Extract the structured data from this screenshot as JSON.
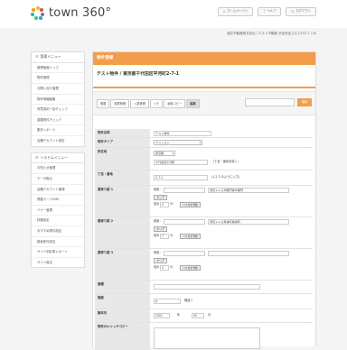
{
  "header": {
    "logo_text": "town 360°",
    "links": [
      {
        "icon": "home-icon",
        "glyph": "⌂",
        "label": "ホームページへ"
      },
      {
        "icon": "help-icon",
        "glyph": "?",
        "label": "ヘルプ"
      },
      {
        "icon": "logout-icon",
        "glyph": "⏻",
        "label": "ログアウト"
      }
    ],
    "login_info": "酒井不動産株式会社 / テスト不動産 渋谷売出さんでログイン中"
  },
  "sidebar": {
    "admin_title": "管理メニュー",
    "admin_items": [
      "管理画面トップ",
      "物件管理",
      "お問い合せ管理",
      "物件情報編集",
      "売買成約一括チェック",
      "重要物件チェック",
      "集計レポート",
      "店舗アカウント設定"
    ],
    "system_title": "システムメニュー",
    "system_items": [
      "お知らせ管理",
      "データ取込",
      "店舗アカウント管理",
      "掲載ページCMS",
      "バナー管理",
      "特集設定",
      "おすすめ物件設定",
      "検索条件設定",
      "サイト別記事レポート",
      "サイト設定"
    ]
  },
  "main": {
    "panel_title": "物件登録",
    "record_title": "テスト物件 / 東京都千代田区平河町2-7-1",
    "tabs": [
      "概要",
      "部屋管理",
      "入居管理",
      "メモ",
      "画像コピー",
      "編集"
    ],
    "search_button": "検索",
    "form": {
      "name_label": "物件名称",
      "name_value": "テスト物件",
      "type_label": "物件タイプ",
      "type_value": "マンション",
      "location_label": "所在地",
      "pref_value": "東京都",
      "address_value": "千代田区平河町",
      "address_note": "（丁目・番地を除く）",
      "chome_label": "丁目・番地",
      "chome_value": "2-7-1",
      "chome_note": "(1-2-3 のように入力)",
      "station1_label": "最寄り駅 1",
      "station2_label": "最寄り駅 2",
      "station3_label": "最寄り駅 3",
      "search_label": "検索：",
      "station1_value": "東京メトロ半蔵門線半蔵門",
      "station2_value": "東京メトロ有楽町線麹町",
      "clear_button": "クリア",
      "walk_label": "徒歩",
      "walk1_value": "5",
      "walk2_value": "7",
      "walk3_value": "0",
      "walk_unit": "分",
      "bus_button": "バス分を登録",
      "area_label": "面積",
      "floors_label": "階建",
      "floors_value": "8",
      "floors_unit": "階建て",
      "built_label": "築年月",
      "built_year": "2002",
      "year_unit": "年",
      "built_month": "05",
      "month_unit": "月",
      "catch_label": "物件のキャッチコピー"
    }
  },
  "colors": {
    "accent": "#f39c4a",
    "label_bg": "#e8e8e8"
  }
}
